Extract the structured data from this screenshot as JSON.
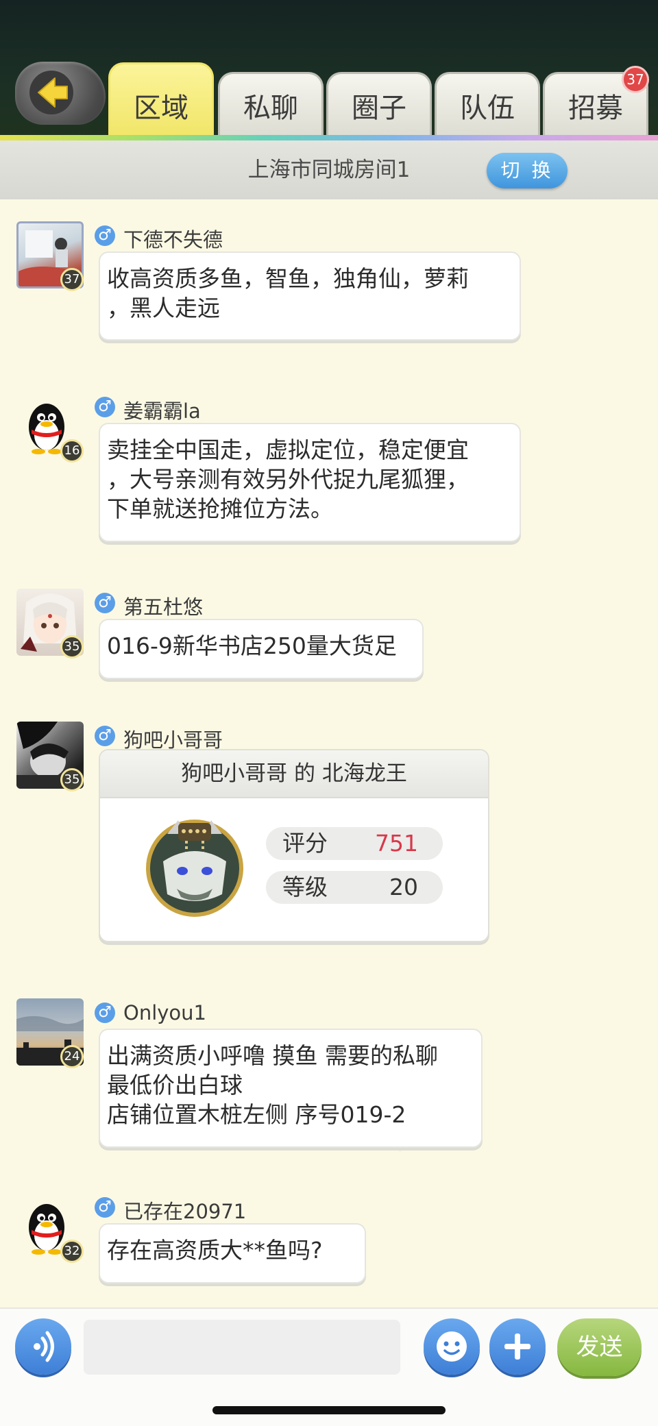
{
  "tabs": [
    {
      "label": "区域",
      "active": true
    },
    {
      "label": "私聊"
    },
    {
      "label": "圈子"
    },
    {
      "label": "队伍"
    },
    {
      "label": "招募",
      "badge": "37"
    }
  ],
  "room": {
    "title": "上海市同城房间1",
    "switch_label": "切 换"
  },
  "messages": [
    {
      "user": "下德不失德",
      "gender_icon": "♂",
      "level": "37",
      "lines": [
        "收高资质多鱼，智鱼，独角仙，萝莉",
        "，黑人走远"
      ]
    },
    {
      "user": "姜霸霸la",
      "gender_icon": "♂",
      "level": "16",
      "lines": [
        "卖挂全中国走，虚拟定位，稳定便宜",
        "，大号亲测有效另外代捉九尾狐狸，",
        "下单就送抢摊位方法。"
      ]
    },
    {
      "user": "第五杜悠",
      "gender_icon": "♂",
      "level": "35",
      "lines": [
        "016-9新华书店250量大货足"
      ]
    },
    {
      "user": "狗吧小哥哥",
      "gender_icon": "♂",
      "level": "35",
      "card": {
        "title": "狗吧小哥哥 的 北海龙王",
        "score_label": "评分",
        "score": "751",
        "grade_label": "等级",
        "grade": "20"
      }
    },
    {
      "user": "Onlyou1",
      "gender_icon": "♂",
      "level": "24",
      "lines": [
        "出满资质小呼噜 摸鱼 需要的私聊",
        "最低价出白球",
        "店铺位置木桩左侧 序号019-2"
      ]
    },
    {
      "user": "已存在20971",
      "gender_icon": "♂",
      "level": "32",
      "lines": [
        "存在高资质大**鱼吗?"
      ]
    }
  ],
  "composer": {
    "value": "",
    "send_label": "发送"
  },
  "colors": {
    "accent_tab": "#f1e567",
    "score": "#d8384a",
    "send": "#86b840",
    "blue_btn": "#3e7fd7"
  }
}
